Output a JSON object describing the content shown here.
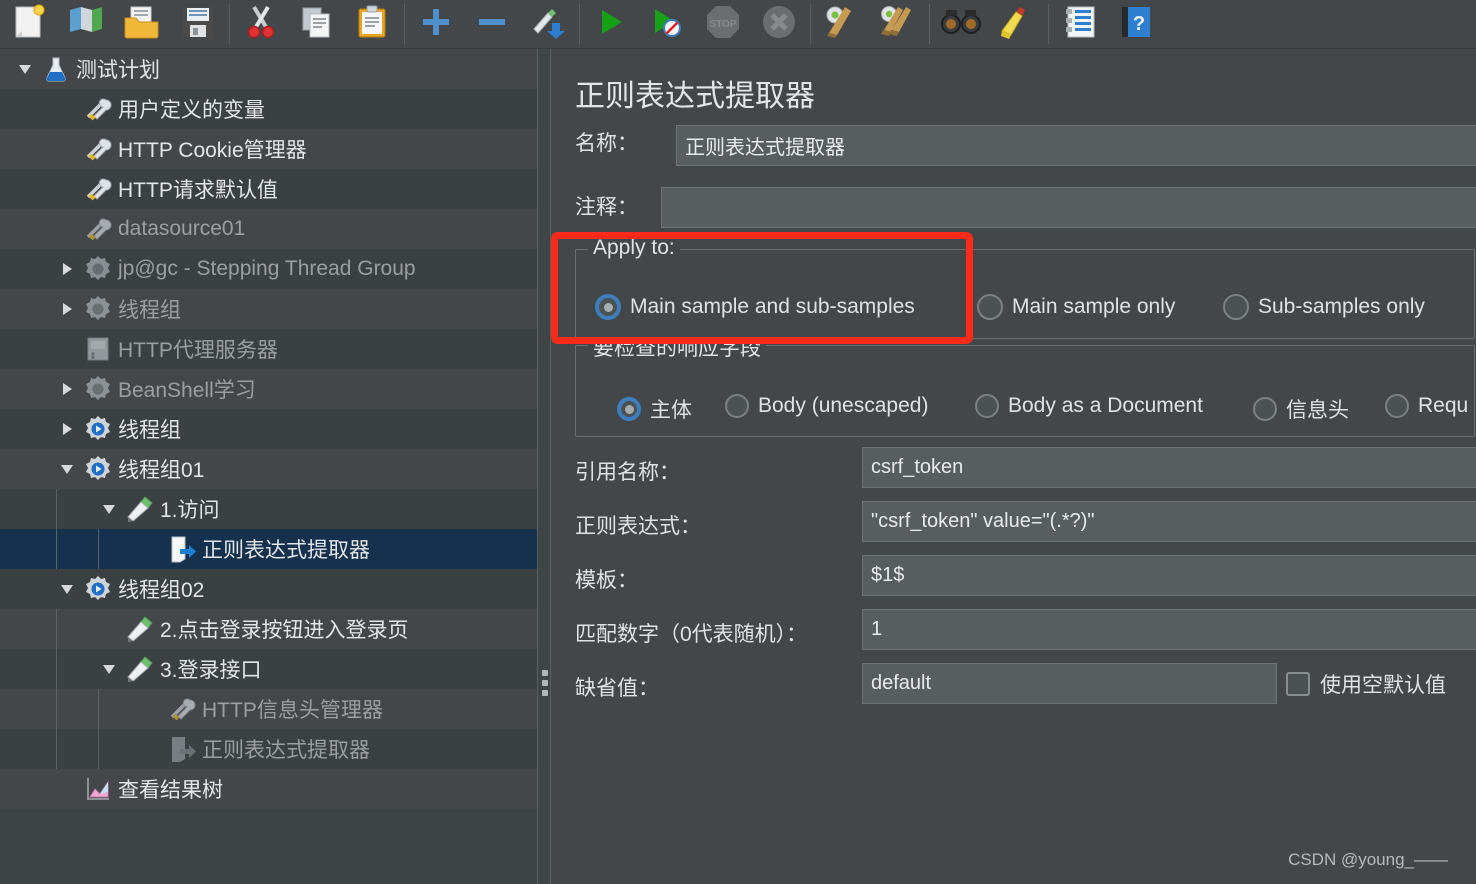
{
  "toolbar": {
    "buttons": [
      {
        "name": "new-test-plan-icon",
        "label": "New",
        "dim": false
      },
      {
        "name": "templates-icon",
        "label": "Templates",
        "dim": false
      },
      {
        "name": "open-icon",
        "label": "Open",
        "dim": false
      },
      {
        "name": "save-icon",
        "label": "Save",
        "dim": false
      },
      {
        "name": "separator",
        "label": "",
        "dim": false
      },
      {
        "name": "cut-icon",
        "label": "Cut",
        "dim": false
      },
      {
        "name": "copy-icon",
        "label": "Copy",
        "dim": false
      },
      {
        "name": "paste-icon",
        "label": "Paste",
        "dim": false
      },
      {
        "name": "separator",
        "label": "",
        "dim": false
      },
      {
        "name": "expand-all-icon",
        "label": "Expand All",
        "dim": false
      },
      {
        "name": "collapse-all-icon",
        "label": "Collapse All",
        "dim": false
      },
      {
        "name": "toggle-icon",
        "label": "Toggle",
        "dim": false
      },
      {
        "name": "separator",
        "label": "",
        "dim": false
      },
      {
        "name": "start-icon",
        "label": "Start",
        "dim": false
      },
      {
        "name": "start-no-timers-icon",
        "label": "Start no pauses",
        "dim": false
      },
      {
        "name": "stop-icon",
        "label": "Stop",
        "dim": true
      },
      {
        "name": "shutdown-icon",
        "label": "Shutdown",
        "dim": true
      },
      {
        "name": "separator",
        "label": "",
        "dim": false
      },
      {
        "name": "clear-icon",
        "label": "Clear",
        "dim": false
      },
      {
        "name": "clear-all-icon",
        "label": "Clear All",
        "dim": false
      },
      {
        "name": "separator",
        "label": "",
        "dim": false
      },
      {
        "name": "search-icon",
        "label": "Search",
        "dim": false
      },
      {
        "name": "reset-search-icon",
        "label": "Reset Search",
        "dim": false
      },
      {
        "name": "separator",
        "label": "",
        "dim": false
      },
      {
        "name": "function-helper-icon",
        "label": "Function Helper",
        "dim": false
      },
      {
        "name": "help-icon",
        "label": "Help",
        "dim": false
      }
    ]
  },
  "tree": {
    "nodes": [
      {
        "label": "测试计划",
        "indent": 0,
        "twisty": "down",
        "icon": "test-plan-icon",
        "dim": false,
        "selected": false
      },
      {
        "label": "用户定义的变量",
        "indent": 1,
        "twisty": "none",
        "icon": "config-element-icon",
        "dim": false,
        "selected": false
      },
      {
        "label": "HTTP Cookie管理器",
        "indent": 1,
        "twisty": "none",
        "icon": "config-element-icon",
        "dim": false,
        "selected": false
      },
      {
        "label": "HTTP请求默认值",
        "indent": 1,
        "twisty": "none",
        "icon": "config-element-icon",
        "dim": false,
        "selected": false
      },
      {
        "label": "datasource01",
        "indent": 1,
        "twisty": "none",
        "icon": "config-element-icon",
        "dim": true,
        "selected": false
      },
      {
        "label": "jp@gc - Stepping Thread Group",
        "indent": 1,
        "twisty": "right",
        "icon": "thread-group-icon",
        "dim": true,
        "selected": false
      },
      {
        "label": "线程组",
        "indent": 1,
        "twisty": "right",
        "icon": "thread-group-icon",
        "dim": true,
        "selected": false
      },
      {
        "label": "HTTP代理服务器",
        "indent": 1,
        "twisty": "none",
        "icon": "proxy-server-icon",
        "dim": true,
        "selected": false
      },
      {
        "label": "BeanShell学习",
        "indent": 1,
        "twisty": "right",
        "icon": "thread-group-icon",
        "dim": true,
        "selected": false
      },
      {
        "label": "线程组",
        "indent": 1,
        "twisty": "right",
        "icon": "thread-group-blue-icon",
        "dim": false,
        "selected": false
      },
      {
        "label": "线程组01",
        "indent": 1,
        "twisty": "down",
        "icon": "thread-group-blue-icon",
        "dim": false,
        "selected": false
      },
      {
        "label": "1.访问",
        "indent": 2,
        "twisty": "down",
        "icon": "http-sampler-icon",
        "dim": false,
        "selected": false
      },
      {
        "label": "正则表达式提取器",
        "indent": 3,
        "twisty": "none",
        "icon": "post-processor-icon",
        "dim": false,
        "selected": true
      },
      {
        "label": "线程组02",
        "indent": 1,
        "twisty": "down",
        "icon": "thread-group-blue-icon",
        "dim": false,
        "selected": false
      },
      {
        "label": "2.点击登录按钮进入登录页",
        "indent": 2,
        "twisty": "none",
        "icon": "http-sampler-icon",
        "dim": false,
        "selected": false
      },
      {
        "label": "3.登录接口",
        "indent": 2,
        "twisty": "down",
        "icon": "http-sampler-icon",
        "dim": false,
        "selected": false
      },
      {
        "label": "HTTP信息头管理器",
        "indent": 3,
        "twisty": "none",
        "icon": "config-element-icon",
        "dim": true,
        "selected": false
      },
      {
        "label": "正则表达式提取器",
        "indent": 3,
        "twisty": "none",
        "icon": "post-processor-icon",
        "dim": true,
        "selected": false
      },
      {
        "label": "查看结果树",
        "indent": 1,
        "twisty": "none",
        "icon": "view-results-tree-icon",
        "dim": false,
        "selected": false
      }
    ]
  },
  "panel": {
    "title": "正则表达式提取器",
    "name_label": "名称：",
    "name_value": "正则表达式提取器",
    "comment_label": "注释：",
    "comment_value": "",
    "apply_to": {
      "legend": "Apply to:",
      "options": [
        {
          "label": "Main sample and sub-samples",
          "selected": true
        },
        {
          "label": "Main sample only",
          "selected": false
        },
        {
          "label": "Sub-samples only",
          "selected": false
        }
      ]
    },
    "response_field": {
      "legend": "要检查的响应字段",
      "options": [
        {
          "label": "主体",
          "selected": true
        },
        {
          "label": "Body (unescaped)",
          "selected": false
        },
        {
          "label": "Body as a Document",
          "selected": false
        },
        {
          "label": "信息头",
          "selected": false
        },
        {
          "label": "Requ",
          "selected": false
        }
      ]
    },
    "fields": [
      {
        "label": "引用名称：",
        "value": "csrf_token",
        "name": "reference-name"
      },
      {
        "label": "正则表达式：",
        "value": "\"csrf_token\" value=\"(.*?)\"",
        "name": "regular-expression"
      },
      {
        "label": "模板：",
        "value": "$1$",
        "name": "template"
      },
      {
        "label": "匹配数字（0代表随机）：",
        "value": "1",
        "name": "match-number"
      },
      {
        "label": "缺省值：",
        "value": "default",
        "name": "default-value"
      }
    ],
    "use_empty_default": {
      "label": "使用空默认值",
      "checked": false
    }
  },
  "watermark": "CSDN @young_——",
  "colors": {
    "accent_blue": "#3d7fbd",
    "selection": "#15314d",
    "annotation_red": "#fc2a18",
    "row_light": "#43474a",
    "row_dark": "#3b4043"
  }
}
